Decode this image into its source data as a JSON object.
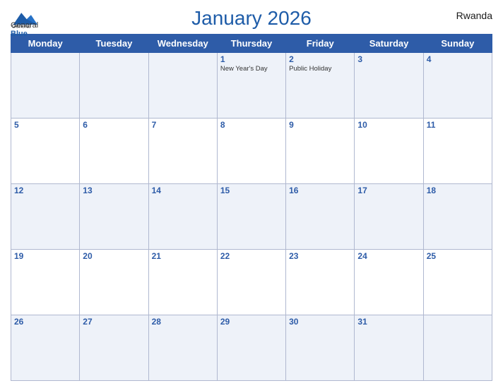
{
  "header": {
    "title": "January 2026",
    "country": "Rwanda",
    "logo": {
      "line1": "General",
      "line2": "Blue"
    }
  },
  "weekdays": [
    "Monday",
    "Tuesday",
    "Wednesday",
    "Thursday",
    "Friday",
    "Saturday",
    "Sunday"
  ],
  "weeks": [
    [
      {
        "day": "",
        "event": ""
      },
      {
        "day": "",
        "event": ""
      },
      {
        "day": "",
        "event": ""
      },
      {
        "day": "1",
        "event": "New Year's Day"
      },
      {
        "day": "2",
        "event": "Public Holiday"
      },
      {
        "day": "3",
        "event": ""
      },
      {
        "day": "4",
        "event": ""
      }
    ],
    [
      {
        "day": "5",
        "event": ""
      },
      {
        "day": "6",
        "event": ""
      },
      {
        "day": "7",
        "event": ""
      },
      {
        "day": "8",
        "event": ""
      },
      {
        "day": "9",
        "event": ""
      },
      {
        "day": "10",
        "event": ""
      },
      {
        "day": "11",
        "event": ""
      }
    ],
    [
      {
        "day": "12",
        "event": ""
      },
      {
        "day": "13",
        "event": ""
      },
      {
        "day": "14",
        "event": ""
      },
      {
        "day": "15",
        "event": ""
      },
      {
        "day": "16",
        "event": ""
      },
      {
        "day": "17",
        "event": ""
      },
      {
        "day": "18",
        "event": ""
      }
    ],
    [
      {
        "day": "19",
        "event": ""
      },
      {
        "day": "20",
        "event": ""
      },
      {
        "day": "21",
        "event": ""
      },
      {
        "day": "22",
        "event": ""
      },
      {
        "day": "23",
        "event": ""
      },
      {
        "day": "24",
        "event": ""
      },
      {
        "day": "25",
        "event": ""
      }
    ],
    [
      {
        "day": "26",
        "event": ""
      },
      {
        "day": "27",
        "event": ""
      },
      {
        "day": "28",
        "event": ""
      },
      {
        "day": "29",
        "event": ""
      },
      {
        "day": "30",
        "event": ""
      },
      {
        "day": "31",
        "event": ""
      },
      {
        "day": "",
        "event": ""
      }
    ]
  ]
}
